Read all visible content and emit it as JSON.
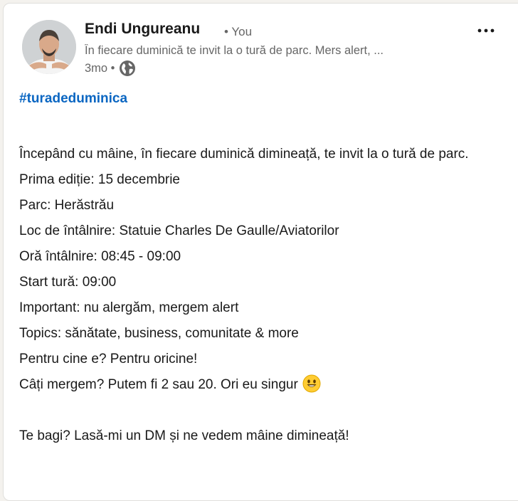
{
  "post": {
    "author": {
      "name": "Endi Ungureanu",
      "relation": "• You",
      "headline": "În fiecare duminică te invit la o tură de parc. Mers alert, ...",
      "timestamp": "3mo •",
      "visibility_icon": "globe-icon"
    },
    "menu_icon": "more-options-icon",
    "hashtag": "#turadeduminica",
    "lines": [
      "Începând cu mâine, în fiecare duminică dimineață, te invit la o tură de parc.",
      "Prima ediție: 15 decembrie",
      "Parc: Herăstrău",
      "Loc de întâlnire: Statuie Charles De Gaulle/Aviatorilor",
      "Oră întâlnire: 08:45 - 09:00",
      "Start tură: 09:00",
      "Important: nu alergăm, mergem alert",
      "Topics: sănătate, business, comunitate & more",
      "Pentru cine e? Pentru oricine!",
      "Câți mergem? Putem fi 2 sau 20. Ori eu singur"
    ],
    "closing": "Te bagi? Lasă-mi un DM și ne vedem mâine dimineață!",
    "emoji": "smiley-emoji",
    "colors": {
      "link": "#0a66c2",
      "text": "#191919",
      "muted": "#666666"
    }
  }
}
